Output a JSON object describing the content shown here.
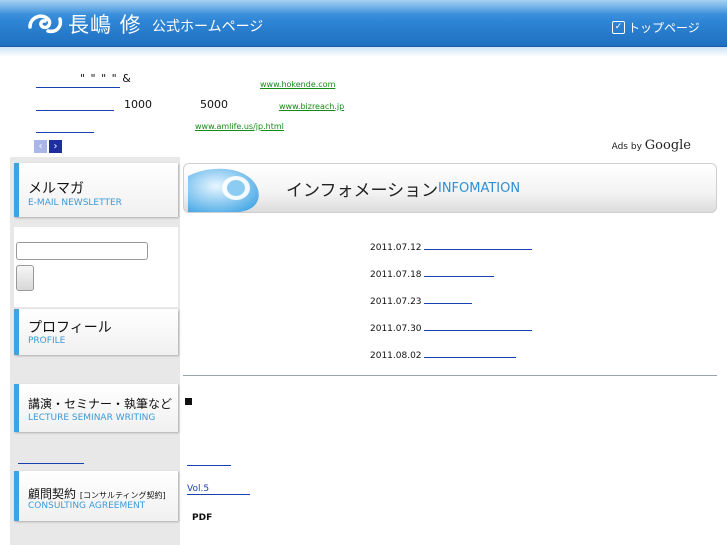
{
  "header": {
    "site_name": "長嶋 修",
    "site_sub": "公式ホームページ",
    "top_link": "トップページ"
  },
  "ads": {
    "row1_marks": "\"   \"      \"       \" &",
    "row1_url": "www.hokende.com",
    "row2_num1": "1000",
    "row2_num2": "5000",
    "row2_url": "www.bizreach.jp",
    "row3_url": "www.amlife.us/jp.html",
    "ads_by": "Ads by",
    "google": "Google"
  },
  "sidebar": {
    "newsletter_title": "メルマガ",
    "newsletter_en": "E-MAIL NEWSLETTER",
    "profile_title": "プロフィール",
    "profile_en": "PROFILE",
    "lecture_title": "講演・セミナー・執筆など",
    "lecture_en": "LECTURE SEMINAR WRITING",
    "consult_title": "顧問契約",
    "consult_small": "[コンサルティング契約]",
    "consult_en": "CONSULTING AGREEMENT"
  },
  "main": {
    "info_title": "インフォメーション",
    "info_en": "INFOMATION",
    "news": [
      {
        "date": "2011.07.12"
      },
      {
        "date": "2011.07.18"
      },
      {
        "date": "2011.07.23"
      },
      {
        "date": "2011.07.30"
      },
      {
        "date": "2011.08.02"
      }
    ],
    "vol": "Vol.5",
    "pdf": "PDF"
  },
  "colors": {
    "header_blue": "#2f86d6",
    "accent_blue": "#3fa3e0",
    "link_blue": "#1a3fb0",
    "ad_url_green": "#168a16"
  }
}
